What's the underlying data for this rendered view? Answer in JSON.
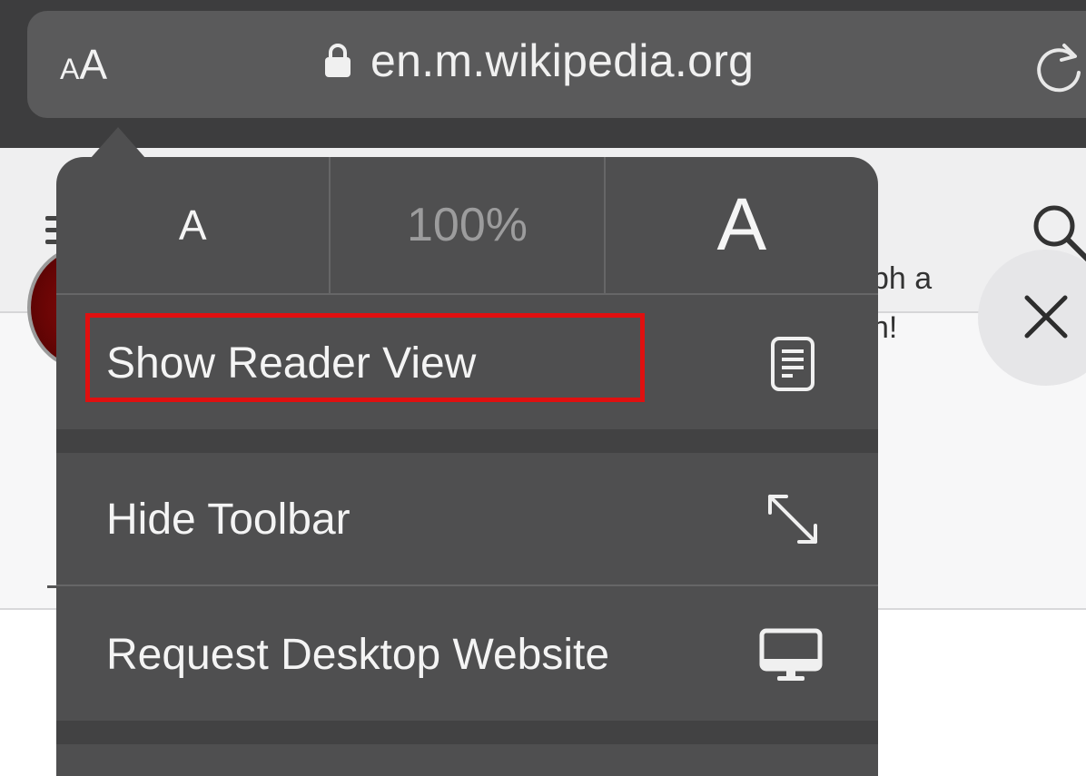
{
  "browser": {
    "text_size_button": {
      "small": "A",
      "big": "A"
    },
    "url": "en.m.wikipedia.org",
    "icons": {
      "lock": "lock-icon",
      "reload": "reload-icon"
    }
  },
  "page": {
    "icons": {
      "menu": "hamburger-icon",
      "search": "search-icon",
      "close": "close-icon"
    },
    "banner_text_lines": [
      "ph a",
      "h!"
    ]
  },
  "menu": {
    "font_row": {
      "smaller_label": "A",
      "zoom_level": "100%",
      "larger_label": "A"
    },
    "items": [
      {
        "label": "Show Reader View",
        "icon": "reader-view-icon",
        "highlighted": true
      },
      {
        "label": "Hide Toolbar",
        "icon": "expand-arrows-icon"
      },
      {
        "label": "Request Desktop Website",
        "icon": "desktop-monitor-icon"
      }
    ]
  },
  "colors": {
    "highlight": "#e01010",
    "menu_background": "#4f4f50",
    "chrome_background": "#3d3d3e"
  }
}
